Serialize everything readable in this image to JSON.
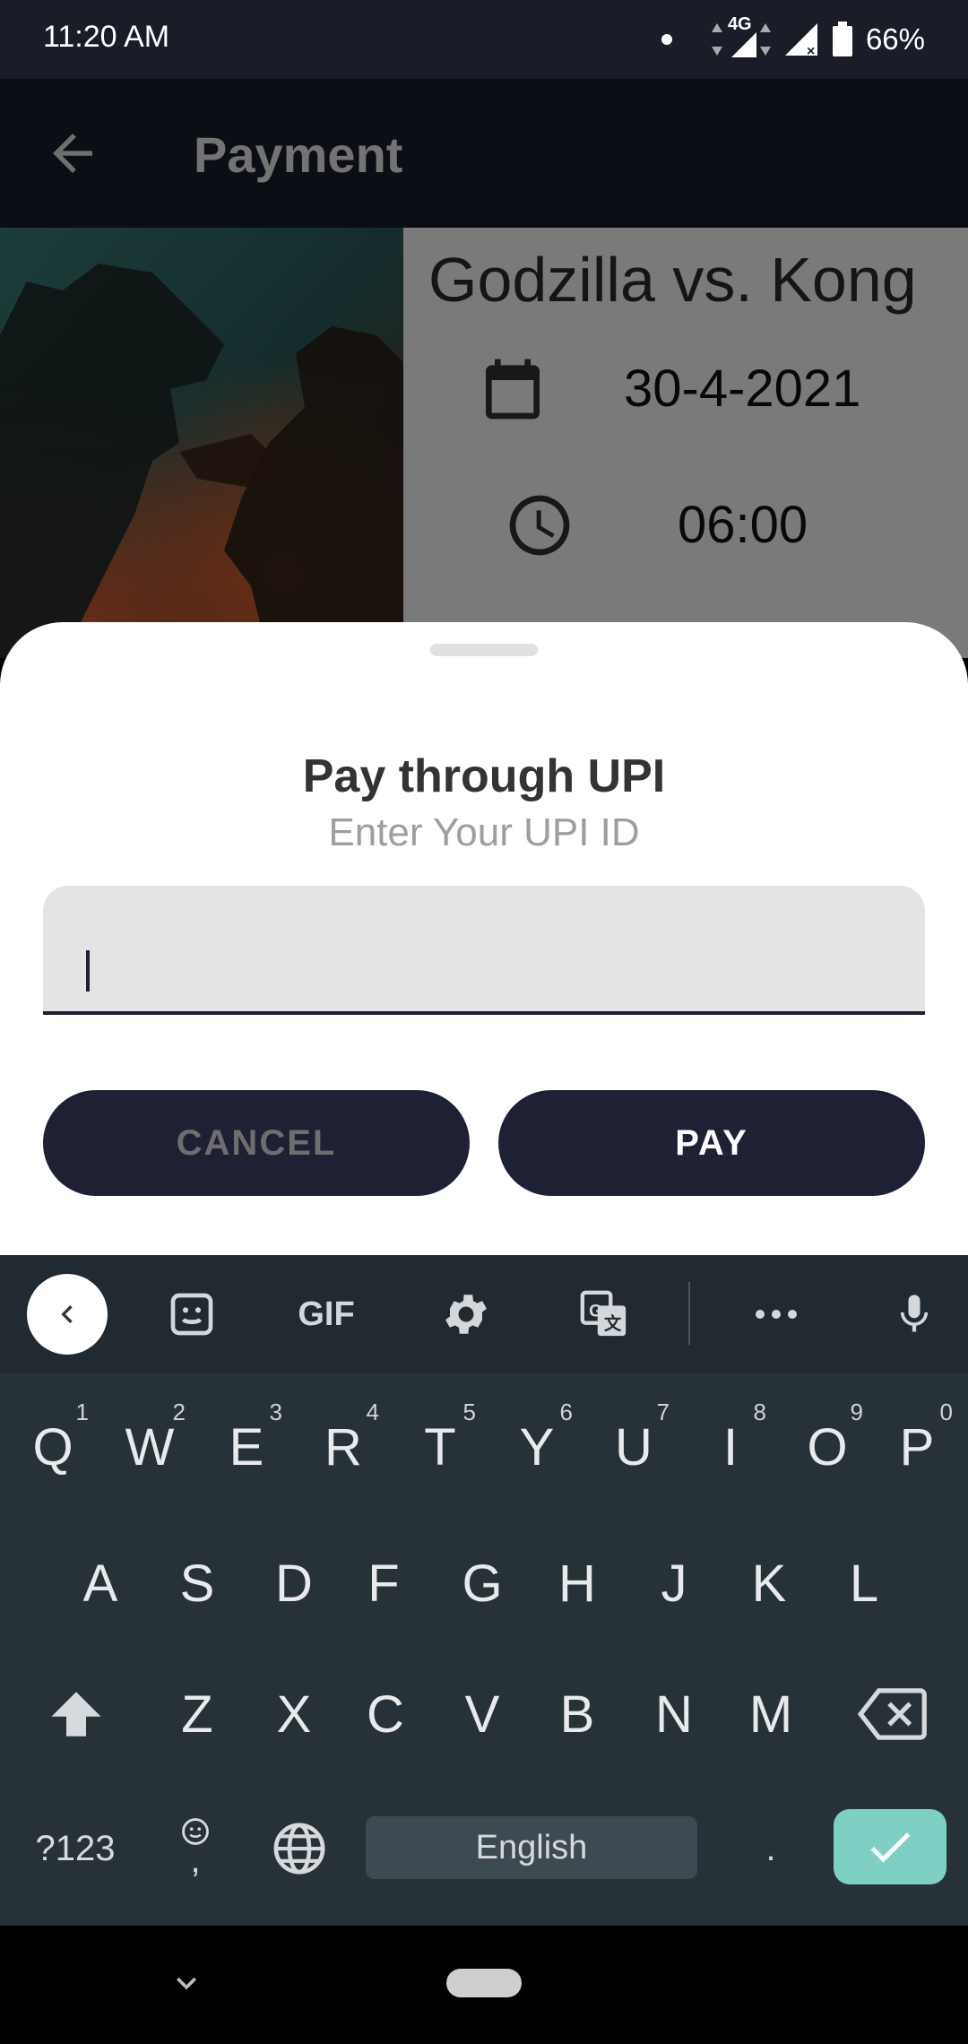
{
  "status_bar": {
    "time": "11:20 AM",
    "network": "4G",
    "battery": "66%"
  },
  "app_bar": {
    "title": "Payment"
  },
  "movie": {
    "title": "Godzilla vs. Kong",
    "date": "30-4-2021",
    "time": "06:00"
  },
  "sheet": {
    "title": "Pay through UPI",
    "subtitle": "Enter Your UPI ID",
    "input_value": "",
    "cancel_label": "CANCEL",
    "pay_label": "PAY"
  },
  "keyboard": {
    "toolbar": {
      "gif_label": "GIF"
    },
    "row1": [
      {
        "key": "Q",
        "hint": "1"
      },
      {
        "key": "W",
        "hint": "2"
      },
      {
        "key": "E",
        "hint": "3"
      },
      {
        "key": "R",
        "hint": "4"
      },
      {
        "key": "T",
        "hint": "5"
      },
      {
        "key": "Y",
        "hint": "6"
      },
      {
        "key": "U",
        "hint": "7"
      },
      {
        "key": "I",
        "hint": "8"
      },
      {
        "key": "O",
        "hint": "9"
      },
      {
        "key": "P",
        "hint": "0"
      }
    ],
    "row2": [
      "A",
      "S",
      "D",
      "F",
      "G",
      "H",
      "J",
      "K",
      "L"
    ],
    "row3": [
      "Z",
      "X",
      "C",
      "V",
      "B",
      "N",
      "M"
    ],
    "symbols_label": "?123",
    "comma_label": ",",
    "space_label": "English",
    "period_label": "."
  },
  "colors": {
    "accent_dark": "#1e2033",
    "enter_key": "#7ecfc4",
    "keyboard_bg": "#273238"
  }
}
